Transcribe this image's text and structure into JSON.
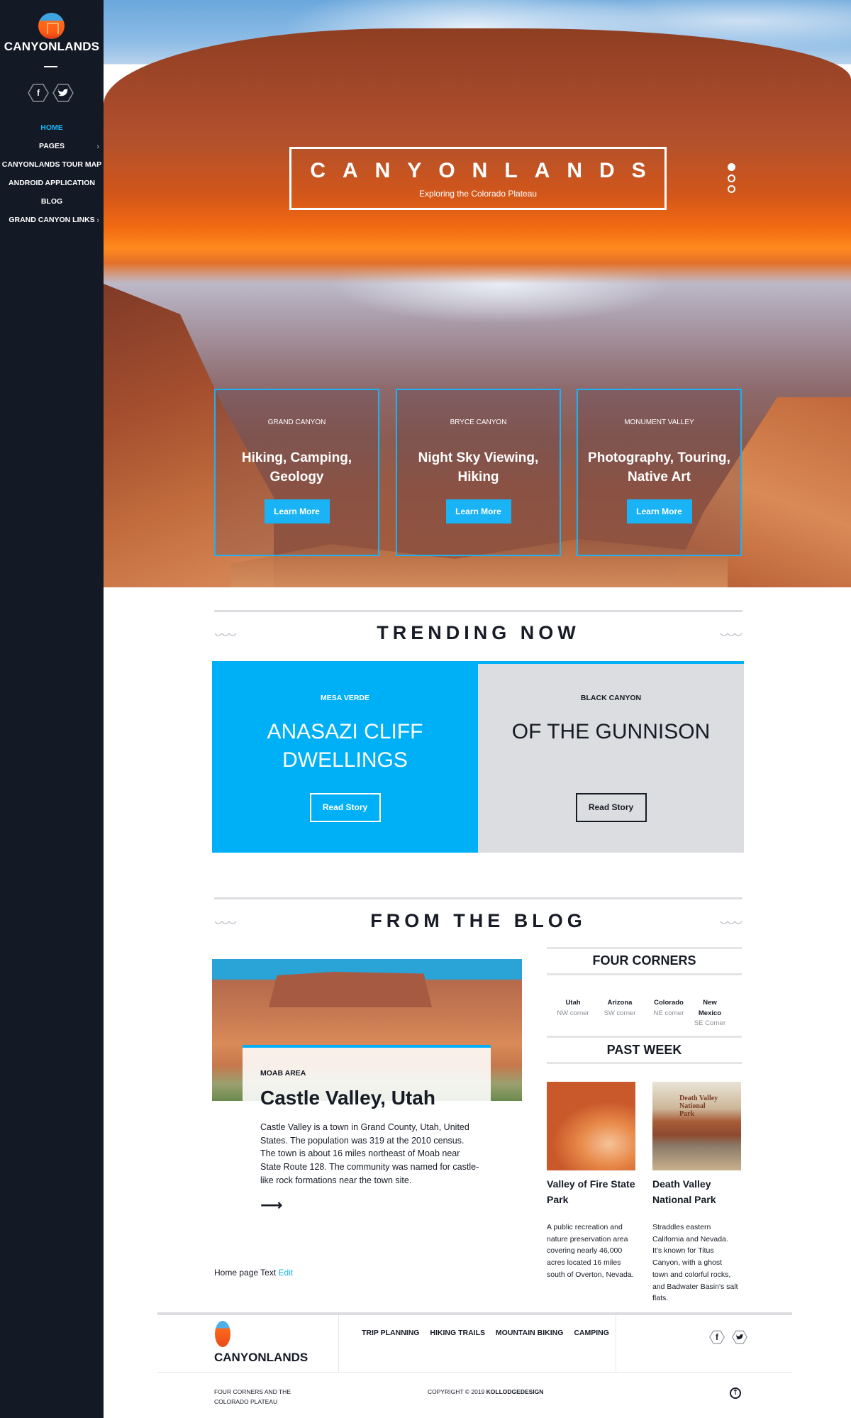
{
  "sidebar": {
    "brand": "CANYONLANDS",
    "social": [
      {
        "icon": "facebook-icon",
        "glyph": "f"
      },
      {
        "icon": "twitter-icon",
        "glyph": "🐦"
      }
    ],
    "nav": [
      {
        "label": "HOME",
        "active": true,
        "submenu": false
      },
      {
        "label": "PAGES",
        "active": false,
        "submenu": true
      },
      {
        "label": "CANYONLANDS TOUR MAP",
        "active": false,
        "submenu": false
      },
      {
        "label": "ANDROID APPLICATION",
        "active": false,
        "submenu": false
      },
      {
        "label": "BLOG",
        "active": false,
        "submenu": false
      },
      {
        "label": "GRAND CANYON LINKS",
        "active": false,
        "submenu": true
      }
    ],
    "chevron": "›"
  },
  "hero": {
    "title": "CANYONLANDS",
    "subtitle": "Exploring the Colorado Plateau",
    "slides": 3,
    "active_slide": 1,
    "cards": [
      {
        "kicker": "GRAND CANYON",
        "title": "Hiking, Camping, Geology",
        "button": "Learn More"
      },
      {
        "kicker": "BRYCE CANYON",
        "title": "Night Sky Viewing, Hiking",
        "button": "Learn More"
      },
      {
        "kicker": "MONUMENT VALLEY",
        "title": "Photography, Touring, Native Art",
        "button": "Learn More"
      }
    ]
  },
  "trending": {
    "title": "TRENDING NOW",
    "items": [
      {
        "kicker": "MESA VERDE",
        "title": "ANASAZI CLIFF DWELLINGS",
        "button": "Read Story"
      },
      {
        "kicker": "BLACK CANYON",
        "title": "OF THE GUNNISON",
        "button": "Read Story"
      }
    ]
  },
  "blog": {
    "title": "FROM THE BLOG",
    "post": {
      "kicker": "MOAB AREA",
      "title": "Castle Valley, Utah",
      "text": "Castle Valley is a town in Grand County, Utah, United States. The population was 319 at the 2010 census. The town is about 16 miles northeast of Moab near State Route 128. The community was named for castle-like rock formations near the town site.",
      "arrow": "⟶"
    },
    "home_text": "Home page Text",
    "edit_label": "Edit"
  },
  "four_corners": {
    "title": "FOUR CORNERS",
    "items": [
      {
        "state": "Utah",
        "corner": "NW corner"
      },
      {
        "state": "Arizona",
        "corner": "SW corner"
      },
      {
        "state": "Colorado",
        "corner": "NE corner"
      },
      {
        "state": "New Mexico",
        "corner": "SE Corner"
      }
    ]
  },
  "past_week": {
    "title": "PAST WEEK",
    "items": [
      {
        "title": "Valley of Fire State Park",
        "text": "A public recreation and nature preservation area covering nearly 46,000 acres located 16 miles south of Overton, Nevada."
      },
      {
        "title": "Death Valley National Park",
        "text": "Straddles eastern California and Nevada. It's known for Titus Canyon, with a ghost town and colorful rocks, and Badwater Basin's salt flats."
      }
    ]
  },
  "footer": {
    "brand": "CANYONLANDS",
    "nav": [
      "TRIP PLANNING",
      "HIKING TRAILS",
      "MOUNTAIN BIKING",
      "CAMPING"
    ],
    "tagline": "FOUR CORNERS AND THE COLORADO PLATEAU",
    "copyright": "COPYRIGHT © 2019",
    "copyright_owner": "KOLLODGEDESIGN",
    "up_glyph": "↑"
  },
  "colors": {
    "accent": "#00b0f7",
    "sidebar": "#141a25",
    "gray_block": "#dcdde0",
    "text": "#161b26"
  }
}
